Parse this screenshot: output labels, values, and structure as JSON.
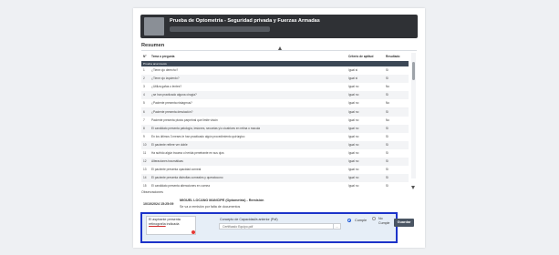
{
  "header": {
    "title": "Prueba de Optometría - Seguridad privada y Fuerzas Armadas"
  },
  "summary": {
    "heading": "Resumen"
  },
  "table": {
    "columns": [
      "N°",
      "Tema o pregunta",
      "Criterio de aptitud",
      "Resultado"
    ],
    "section": "Prueba anamnesis",
    "rows": [
      [
        "1",
        "¿Tiene ojo derecho?",
        "Igual si",
        "Si"
      ],
      [
        "2",
        "¿Tiene ojo izquierdo?",
        "Igual si",
        "Si"
      ],
      [
        "3",
        "¿Utiliza gafas o lentes?",
        "Igual no",
        "No"
      ],
      [
        "4",
        "¿se han practicado alguna cirugía?",
        "Igual no",
        "Si"
      ],
      [
        "5",
        "¿Paciente presenta nistagmus?",
        "Igual no",
        "No"
      ],
      [
        "6",
        "¿Paciente presenta desviación?",
        "Igual no",
        "Si"
      ],
      [
        "7",
        "Paciente presenta ptosis parpebral que limite visión",
        "Igual no",
        "No"
      ],
      [
        "8",
        "El candidato presenta patología, lesiones, secuelas y/o cicatrices en retina o macula",
        "Igual no",
        "Si"
      ],
      [
        "9",
        "En los últimos 3 meses le han practicado algún procedimiento quirúrgico",
        "Igual no",
        "Si"
      ],
      [
        "10",
        "El paciente refiere ver doble",
        "Igual no",
        "Si"
      ],
      [
        "11",
        "Ha sufrido algún trauma o herida penetrante en sus ojos",
        "Igual no",
        "Si"
      ],
      [
        "12",
        "Alteraciones traumáticas",
        "Igual no",
        "Si"
      ],
      [
        "13",
        "El paciente presenta opacidad corneal",
        "Igual no",
        "Si"
      ],
      [
        "14",
        "El paciente presenta distrofias corneales y queratocono",
        "Igual no",
        "Si"
      ],
      [
        "15",
        "El candidato presenta alteraciones en cornea",
        "Igual no",
        "Si"
      ]
    ]
  },
  "observations": {
    "label": "Observaciones",
    "date": "10/10/2024 15:25:09",
    "author": "MIGUEL LOCANO MANCIPE (Optometría) - Remisión",
    "text": "Se va a remisión por falta de documentos"
  },
  "form": {
    "textarea_value": "El aspirante presenta retinografía indicada",
    "textarea_plain": "El aspirante presenta ",
    "textarea_underlined": "retinografía",
    "textarea_rest": " indicada",
    "concept_label": "Concepto de Capacidad/a anterior (Pdf)",
    "file_value": "Certificado Equipo.pdf",
    "file_button": "...",
    "radio_cumple": "Cumple",
    "radio_no_cumple_1": "No",
    "radio_no_cumple_2": "Cumple",
    "save_label": "Guardar"
  },
  "colors": {
    "highlight_border": "#1c33c9",
    "header_bg": "#2f3135",
    "section_bg": "#3c4856"
  }
}
